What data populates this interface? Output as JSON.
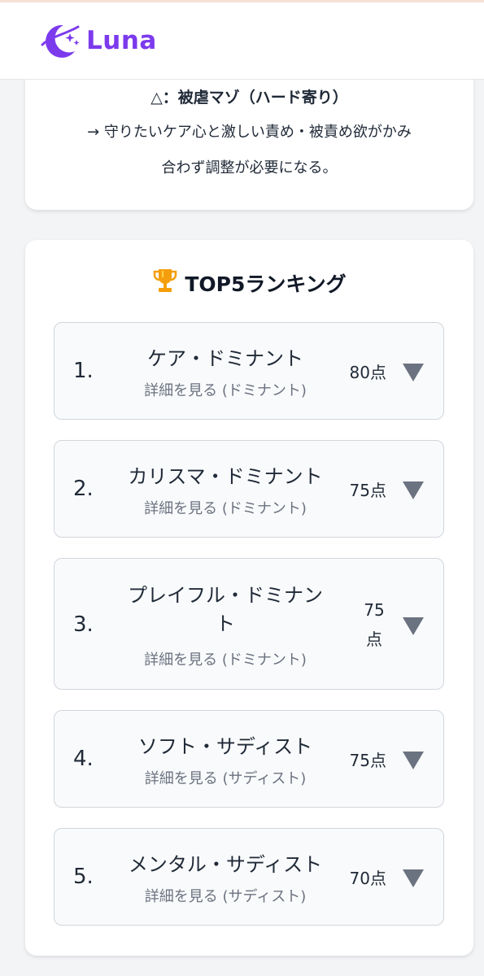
{
  "header": {
    "brand": "Luna",
    "logo_icon": "moon-sparkle-icon",
    "brand_color": "#7c3aed"
  },
  "note": {
    "title": "△：被虐マゾ（ハード寄り）",
    "line1": "→ 守りたいケア心と激しい責め・被責め欲がかみ",
    "line2": "合わず調整が必要になる。"
  },
  "ranking": {
    "icon": "trophy-icon",
    "title": "TOP5ランキング",
    "items": [
      {
        "rank": "1.",
        "name": "ケア・ドミナント",
        "link": "詳細を見る (ドミナント)",
        "score": "80点"
      },
      {
        "rank": "2.",
        "name": "カリスマ・ドミナント",
        "link": "詳細を見る (ドミナント)",
        "score": "75点"
      },
      {
        "rank": "3.",
        "name_line1": "プレイフル・ドミナン",
        "name_line2": "ト",
        "link": "詳細を見る (ドミナント)",
        "score_line1": "75",
        "score_line2": "点"
      },
      {
        "rank": "4.",
        "name": "ソフト・サディスト",
        "link": "詳細を見る (サディスト)",
        "score": "75点"
      },
      {
        "rank": "5.",
        "name": "メンタル・サディスト",
        "link": "詳細を見る (サディスト)",
        "score": "70点"
      }
    ]
  }
}
